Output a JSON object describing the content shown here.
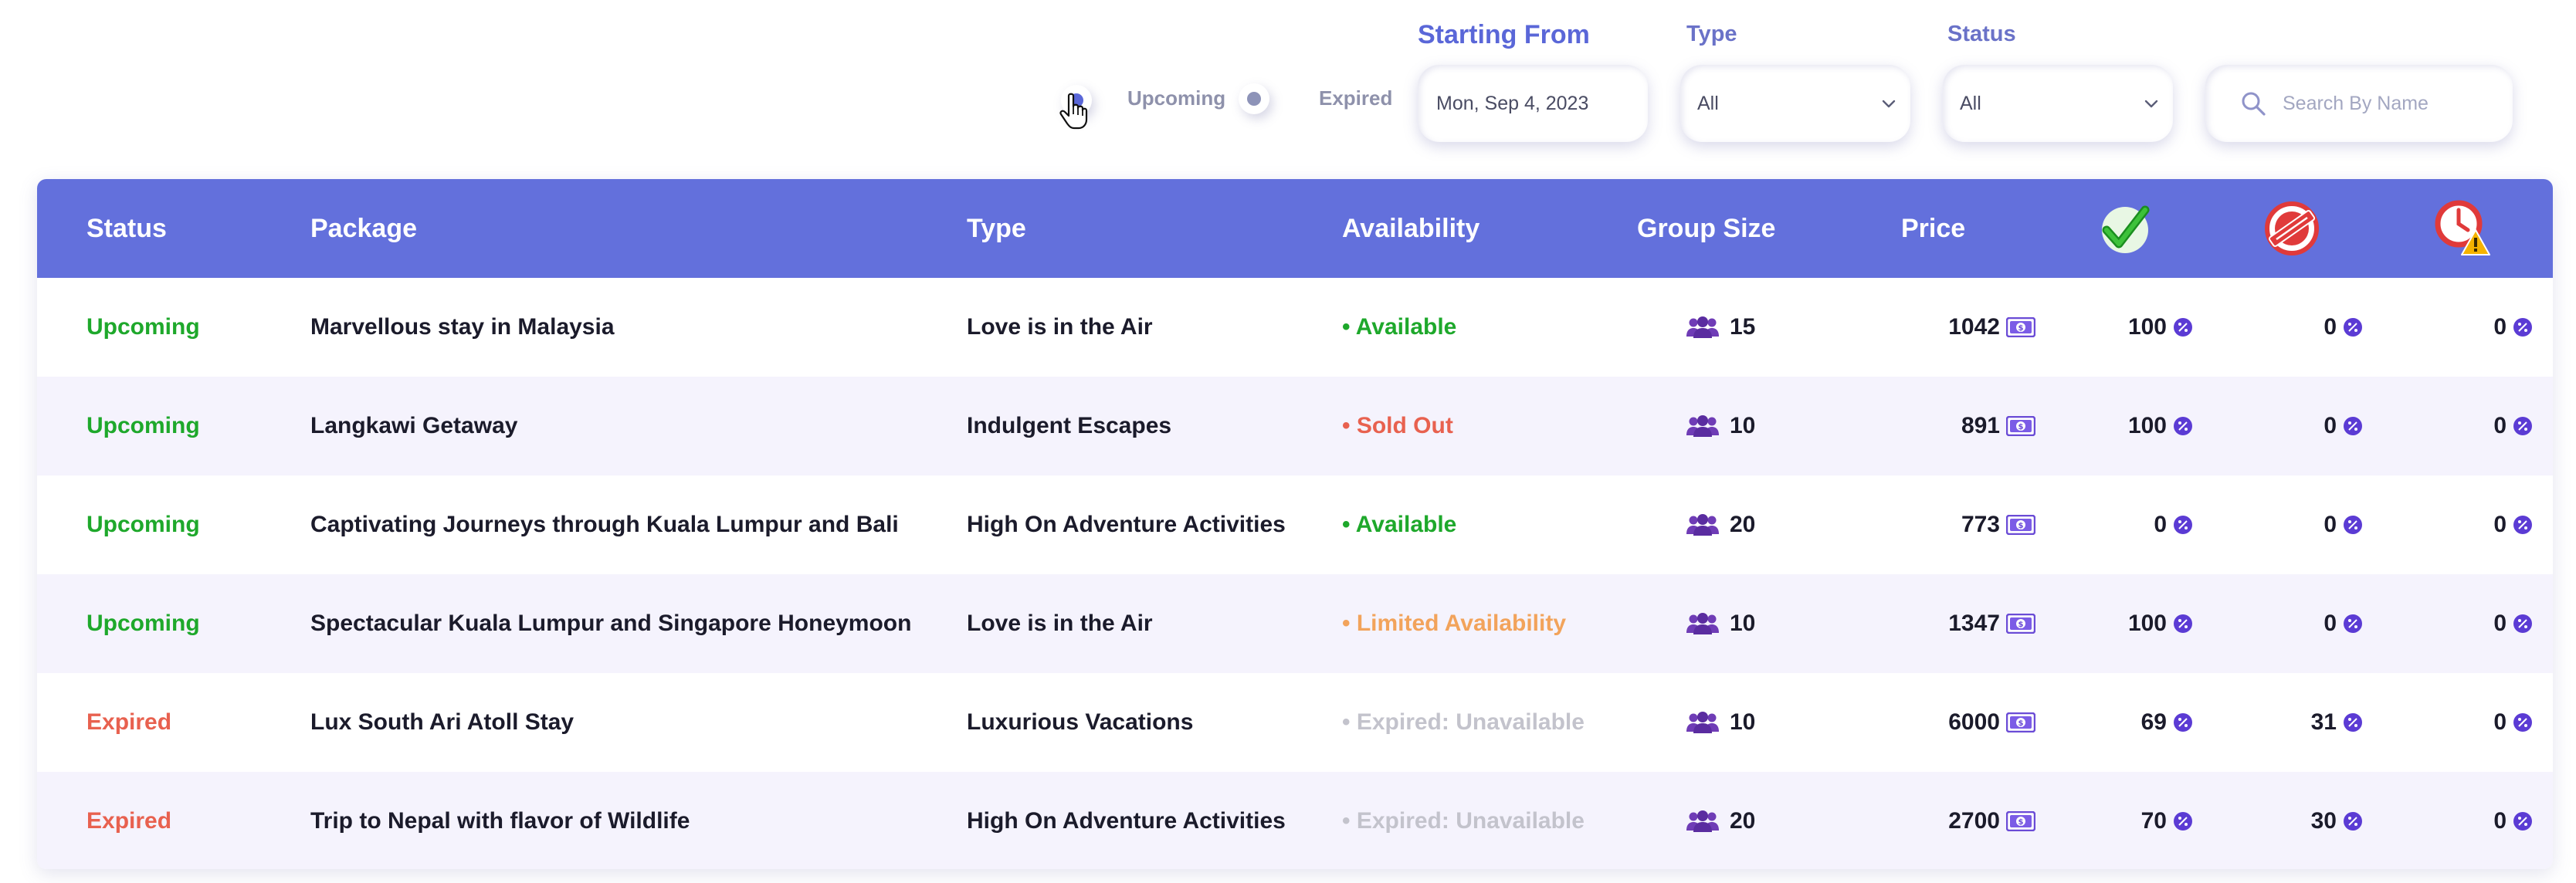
{
  "filters": {
    "show": {
      "upcoming_label": "Upcoming",
      "expired_label": "Expired"
    },
    "starting_from": {
      "label": "Starting From",
      "value": "Mon, Sep 4, 2023"
    },
    "type": {
      "label": "Type",
      "value": "All"
    },
    "status": {
      "label": "Status",
      "value": "All"
    },
    "search": {
      "placeholder": "Search By Name"
    }
  },
  "table": {
    "headers": {
      "status": "Status",
      "package": "Package",
      "type": "Type",
      "availability": "Availability",
      "group_size": "Group Size",
      "price": "Price",
      "confirmed_icon": "green-check-icon",
      "cancelled_icon": "cancelled-stamp-icon",
      "pending_icon": "clock-warning-icon"
    },
    "rows": [
      {
        "status": "Upcoming",
        "package": "Marvellous stay in Malaysia",
        "type": "Love is in the Air",
        "availability": "• Available",
        "group_size": "15",
        "price": "1042",
        "confirmed": "100",
        "cancelled": "0",
        "pending": "0"
      },
      {
        "status": "Upcoming",
        "package": "Langkawi Getaway",
        "type": "Indulgent Escapes",
        "availability": "• Sold Out",
        "group_size": "10",
        "price": "891",
        "confirmed": "100",
        "cancelled": "0",
        "pending": "0"
      },
      {
        "status": "Upcoming",
        "package": "Captivating Journeys through Kuala Lumpur and Bali",
        "type": "High On Adventure Activities",
        "availability": "• Available",
        "group_size": "20",
        "price": "773",
        "confirmed": "0",
        "cancelled": "0",
        "pending": "0"
      },
      {
        "status": "Upcoming",
        "package": "Spectacular Kuala Lumpur and Singapore Honeymoon",
        "type": "Love is in the Air",
        "availability": "• Limited Availability",
        "group_size": "10",
        "price": "1347",
        "confirmed": "100",
        "cancelled": "0",
        "pending": "0"
      },
      {
        "status": "Expired",
        "package": "Lux South Ari Atoll Stay",
        "type": "Luxurious Vacations",
        "availability": "• Expired: Unavailable",
        "group_size": "10",
        "price": "6000",
        "confirmed": "69",
        "cancelled": "31",
        "pending": "0"
      },
      {
        "status": "Expired",
        "package": "Trip to Nepal with flavor of Wildlife",
        "type": "High On Adventure Activities",
        "availability": "• Expired: Unavailable",
        "group_size": "20",
        "price": "2700",
        "confirmed": "70",
        "cancelled": "30",
        "pending": "0"
      }
    ]
  },
  "colors": {
    "accent": "#5a67d8",
    "header_bg": "#6370dc",
    "upcoming": "#1ea82b",
    "expired": "#e8614f",
    "limited": "#f2a35b",
    "unavailable": "#c3c3cc",
    "alt_row": "#f5f3fd"
  }
}
